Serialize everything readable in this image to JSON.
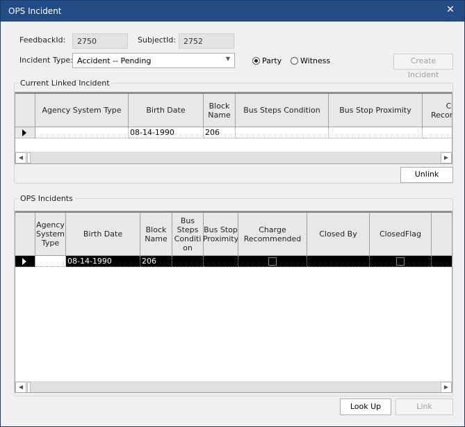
{
  "window": {
    "title": "OPS Incident",
    "close_icon": "close-icon"
  },
  "form": {
    "feedback_label": "FeedbackId:",
    "feedback_value": "2750",
    "subject_label": "SubjectId:",
    "subject_value": "2752",
    "incident_type_label": "Incident Type:",
    "incident_type_value": "Accident -- Pending",
    "radio_party": "Party",
    "radio_witness": "Witness",
    "selected_radio": "Party",
    "create_button": "Create Incident"
  },
  "linked": {
    "title": "Current Linked Incident",
    "columns": [
      "Agency System Type",
      "Birth Date",
      "Block\nName",
      "Bus Steps Condition",
      "Bus Stop Proximity",
      "Charge\nRecommended"
    ],
    "rows": [
      {
        "agency": "",
        "birth": "08-14-1990",
        "block": "206",
        "steps": "",
        "prox": "",
        "charge": ""
      }
    ],
    "unlink_button": "Unlink"
  },
  "ops": {
    "title": "OPS Incidents",
    "columns": [
      "Agency\nSystem\nType",
      "Birth Date",
      "Block\nName",
      "Bus\nSteps\nConditi\non",
      "Bus Stop\nProximity",
      "Charge\nRecommended",
      "Closed By",
      "ClosedFlag"
    ],
    "rows": [
      {
        "agency": "",
        "birth": "08-14-1990",
        "block": "206",
        "steps": "",
        "prox": "",
        "charge_checked": false,
        "closed_by": "",
        "closed_flag_checked": false,
        "selected": true
      }
    ],
    "lookup_button": "Look Up",
    "link_button": "Link"
  }
}
